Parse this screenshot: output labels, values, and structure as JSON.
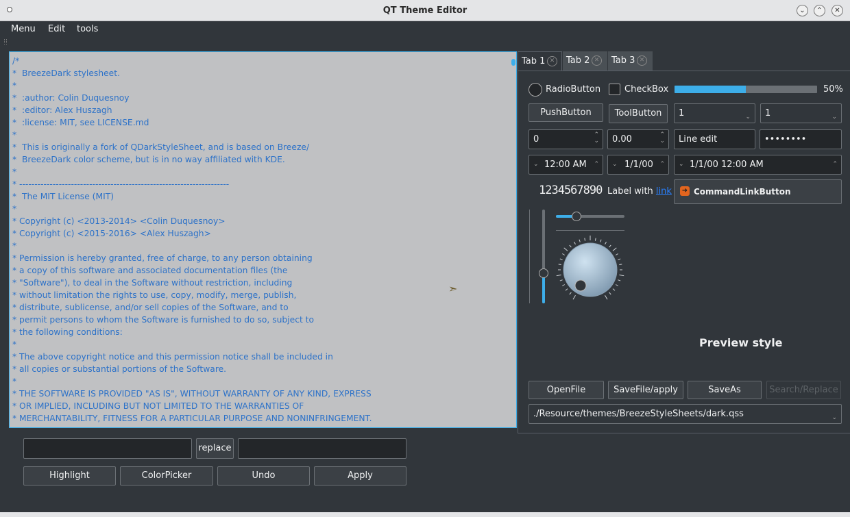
{
  "window": {
    "title": "QT Theme Editor"
  },
  "menubar": {
    "items": [
      "Menu",
      "Edit",
      "tools"
    ]
  },
  "editor": {
    "lines": [
      "/*",
      "*  BreezeDark stylesheet.",
      "*",
      "*  :author: Colin Duquesnoy",
      "*  :editor: Alex Huszagh",
      "*  :license: MIT, see LICENSE.md",
      "*",
      "*  This is originally a fork of QDarkStyleSheet, and is based on Breeze/",
      "*  BreezeDark color scheme, but is in no way affiliated with KDE.",
      "*",
      "* ---------------------------------------------------------------------",
      "*  The MIT License (MIT)",
      "*",
      "* Copyright (c) <2013-2014> <Colin Duquesnoy>",
      "* Copyright (c) <2015-2016> <Alex Huszagh>",
      "*",
      "* Permission is hereby granted, free of charge, to any person obtaining",
      "* a copy of this software and associated documentation files (the",
      "* \"Software\"), to deal in the Software without restriction, including",
      "* without limitation the rights to use, copy, modify, merge, publish,",
      "* distribute, sublicense, and/or sell copies of the Software, and to",
      "* permit persons to whom the Software is furnished to do so, subject to",
      "* the following conditions:",
      "*",
      "* The above copyright notice and this permission notice shall be included in",
      "* all copies or substantial portions of the Software.",
      "*",
      "* THE SOFTWARE IS PROVIDED \"AS IS\", WITHOUT WARRANTY OF ANY KIND, EXPRESS",
      "* OR IMPLIED, INCLUDING BUT NOT LIMITED TO THE WARRANTIES OF",
      "* MERCHANTABILITY, FITNESS FOR A PARTICULAR PURPOSE AND NONINFRINGEMENT.",
      "*"
    ]
  },
  "editor_tools": {
    "replace_label": "replace",
    "highlight_label": "Highlight",
    "colorpicker_label": "ColorPicker",
    "undo_label": "Undo",
    "apply_label": "Apply"
  },
  "tabs": [
    "Tab 1",
    "Tab 2",
    "Tab 3"
  ],
  "preview": {
    "radio_label": "RadioButton",
    "checkbox_label": "CheckBox",
    "progress_percent": 50,
    "progress_text": "50%",
    "push_label": "PushButton",
    "tool_label": "ToolButton",
    "combo1_value": "1",
    "combo2_value": "1",
    "spin_int": "0",
    "spin_double": "0.00",
    "line_edit": "Line edit",
    "password": "••••••••",
    "time_value": "12:00 AM",
    "date_value": "1/1/00",
    "datetime_value": "1/1/00 12:00 AM",
    "lcd_value": "1234567890",
    "label_prefix": "Label with ",
    "label_link": "link",
    "commandlink_label": "CommandLinkButton",
    "hslider_value": 30,
    "vslider_value": 32,
    "preview_title": "Preview style",
    "openfile_label": "OpenFile",
    "savefile_label": "SaveFile/apply",
    "saveas_label": "SaveAs",
    "search_label": "Search/Replace",
    "path_value": "./Resource/themes/BreezeStyleSheets/dark.qss"
  },
  "colors": {
    "accent": "#3daee9",
    "window_bg": "#31363b",
    "editor_bg": "#c0c1c3",
    "editor_text": "#2d72c8"
  }
}
